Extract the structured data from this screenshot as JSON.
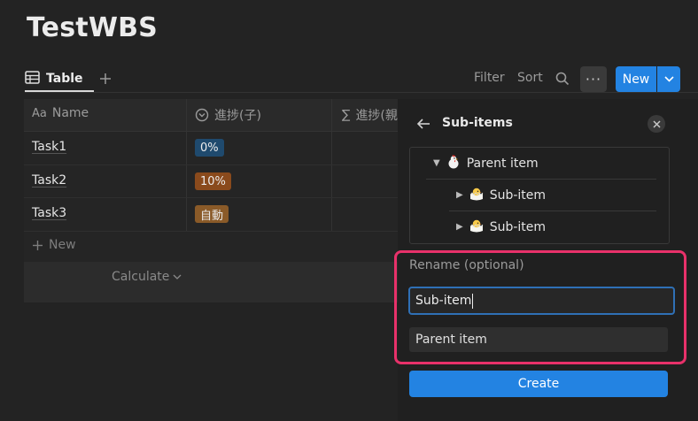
{
  "page": {
    "title": "TestWBS"
  },
  "views": {
    "tabs": [
      {
        "label": "Table"
      }
    ]
  },
  "toolbar": {
    "filter_label": "Filter",
    "sort_label": "Sort",
    "more_label": "···",
    "new_label": "New"
  },
  "table": {
    "columns": [
      {
        "icon_text": "Aa",
        "label": "Name"
      },
      {
        "label": "進捗(子)"
      },
      {
        "icon_text": "∑",
        "label": "進捗(親"
      }
    ],
    "rows": [
      {
        "name": "Task1",
        "tag": "0%",
        "tag_color": "#1f4a6e"
      },
      {
        "name": "Task2",
        "tag": "10%",
        "tag_color": "#8a4a1c"
      },
      {
        "name": "Task3",
        "tag": "自動",
        "tag_color": "#8a5a28"
      }
    ],
    "new_row_label": "New",
    "calculate_label": "Calculate"
  },
  "panel": {
    "title": "Sub-items",
    "tree": [
      {
        "label": "Parent item",
        "level": 0,
        "expanded": true,
        "icon": "chicken-emoji"
      },
      {
        "label": "Sub-item",
        "level": 1,
        "expanded": false,
        "icon": "chick-emoji"
      },
      {
        "label": "Sub-item",
        "level": 1,
        "expanded": false,
        "icon": "chick-emoji"
      }
    ],
    "rename_label": "Rename (optional)",
    "rename_value": "Sub-item",
    "parent_value": "Parent item",
    "create_label": "Create"
  },
  "colors": {
    "accent": "#2383e2",
    "highlight": "#e8316a",
    "background": "#232323"
  }
}
